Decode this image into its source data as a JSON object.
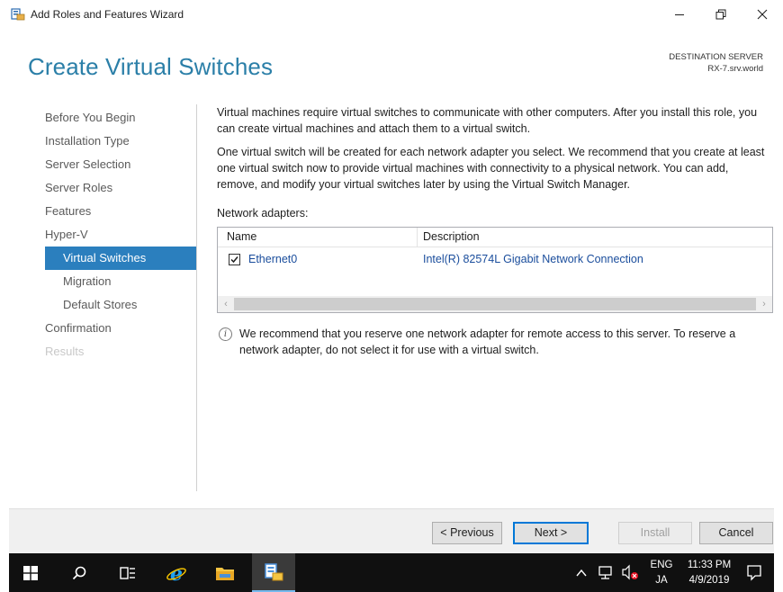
{
  "window": {
    "title": "Add Roles and Features Wizard",
    "controls": {
      "minimize": "minimize",
      "maximize": "restore",
      "close": "close"
    }
  },
  "header": {
    "page_title": "Create Virtual Switches",
    "destination_label": "DESTINATION SERVER",
    "destination_server": "RX-7.srv.world"
  },
  "nav": {
    "items": [
      {
        "label": "Before You Begin",
        "state": "normal"
      },
      {
        "label": "Installation Type",
        "state": "normal"
      },
      {
        "label": "Server Selection",
        "state": "normal"
      },
      {
        "label": "Server Roles",
        "state": "normal"
      },
      {
        "label": "Features",
        "state": "normal"
      },
      {
        "label": "Hyper-V",
        "state": "normal"
      },
      {
        "label": "Virtual Switches",
        "state": "selected"
      },
      {
        "label": "Migration",
        "state": "sub"
      },
      {
        "label": "Default Stores",
        "state": "sub"
      },
      {
        "label": "Confirmation",
        "state": "normal"
      },
      {
        "label": "Results",
        "state": "disabled"
      }
    ]
  },
  "content": {
    "para1": "Virtual machines require virtual switches to communicate with other computers. After you install this role, you can create virtual machines and attach them to a virtual switch.",
    "para2": "One virtual switch will be created for each network adapter you select. We recommend that you create at least one virtual switch now to provide virtual machines with connectivity to a physical network. You can add, remove, and modify your virtual switches later by using the Virtual Switch Manager.",
    "adapters_label": "Network adapters:",
    "table": {
      "columns": [
        "Name",
        "Description"
      ],
      "rows": [
        {
          "checked": true,
          "name": "Ethernet0",
          "description": "Intel(R) 82574L Gigabit Network Connection"
        }
      ]
    },
    "info_text": "We recommend that you reserve one network adapter for remote access to this server. To reserve a network adapter, do not select it for use with a virtual switch."
  },
  "footer": {
    "previous": "< Previous",
    "next": "Next >",
    "install": "Install",
    "cancel": "Cancel"
  },
  "taskbar": {
    "language_top": "ENG",
    "language_bottom": "JA",
    "time": "11:33 PM",
    "date": "4/9/2019",
    "colors": {
      "background": "#101010",
      "active": "#3a3a3a",
      "accent": "#76b9ed"
    }
  },
  "colors": {
    "title_blue": "#2b7fa8",
    "selection_blue": "#2b7fbe",
    "link_blue": "#1a4d9c"
  }
}
